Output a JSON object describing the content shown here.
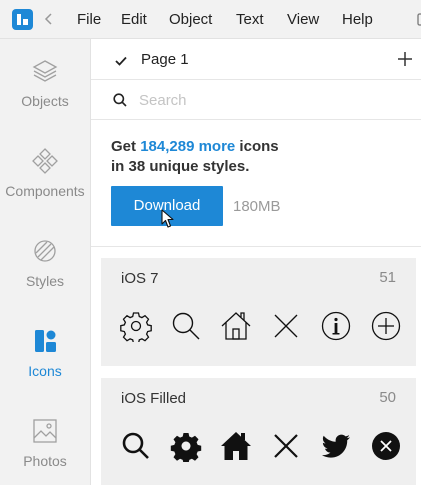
{
  "menubar": {
    "items": [
      "File",
      "Edit",
      "Object",
      "Text",
      "View",
      "Help"
    ],
    "logo_icon": "app-logo-icon",
    "back_icon": "chevron-left-icon"
  },
  "sidebar": {
    "items": [
      {
        "label": "Objects",
        "icon": "layers-icon",
        "active": false
      },
      {
        "label": "Components",
        "icon": "components-icon",
        "active": false
      },
      {
        "label": "Styles",
        "icon": "styles-icon",
        "active": false
      },
      {
        "label": "Icons",
        "icon": "icons-icon",
        "active": true
      },
      {
        "label": "Photos",
        "icon": "photos-icon",
        "active": false
      }
    ]
  },
  "page": {
    "name": "Page 1",
    "add_icon": "plus-icon"
  },
  "search": {
    "placeholder": "Search",
    "value": ""
  },
  "promo": {
    "prefix": "Get ",
    "accent": "184,289 more",
    "suffix": " icons",
    "line2": "in 38 unique styles.",
    "button_label": "Download",
    "size": "180MB"
  },
  "icon_sets": [
    {
      "title": "iOS 7",
      "count": "51",
      "icons": [
        "gear-outline-icon",
        "search-outline-icon",
        "home-outline-icon",
        "close-outline-icon",
        "info-outline-icon",
        "add-outline-icon"
      ]
    },
    {
      "title": "iOS Filled",
      "count": "50",
      "icons": [
        "search-filled-icon",
        "gear-filled-icon",
        "home-filled-icon",
        "close-filled-icon",
        "twitter-filled-icon",
        "close-circle-filled-icon"
      ]
    }
  ],
  "colors": {
    "accent": "#1e88d6",
    "sidebar_bg": "#f2f2f2",
    "set_bg": "#efefef"
  }
}
